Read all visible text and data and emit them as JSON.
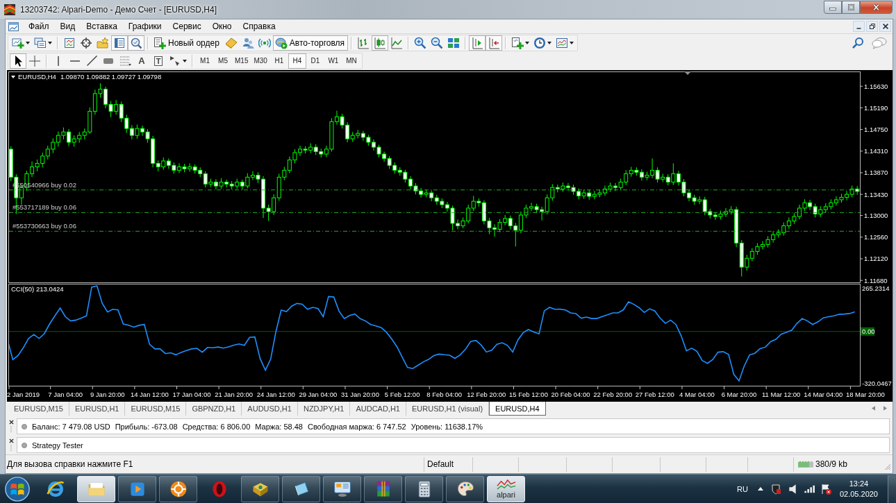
{
  "window": {
    "title": "13203742: Alpari-Demo - Демо Счет - [EURUSD,H4]"
  },
  "menu": [
    "Файл",
    "Вид",
    "Вставка",
    "Графики",
    "Сервис",
    "Окно",
    "Справка"
  ],
  "toolbar": [
    {
      "kind": "new-chart",
      "dropdown": true,
      "pressed": false
    },
    {
      "kind": "profiles",
      "dropdown": true,
      "pressed": false
    },
    {
      "kind": "separator"
    },
    {
      "kind": "market-watch",
      "dropdown": false,
      "pressed": false
    },
    {
      "kind": "data-window",
      "dropdown": false,
      "pressed": false
    },
    {
      "kind": "navigator",
      "dropdown": false,
      "pressed": false
    },
    {
      "kind": "terminal",
      "dropdown": false,
      "pressed": true
    },
    {
      "kind": "tester",
      "dropdown": false,
      "pressed": true
    },
    {
      "kind": "separator"
    },
    {
      "kind": "new-order",
      "label": "Новый ордер",
      "dropdown": false,
      "pressed": false
    },
    {
      "kind": "editor",
      "dropdown": false,
      "pressed": false
    },
    {
      "kind": "signals",
      "dropdown": false,
      "pressed": false
    },
    {
      "kind": "market",
      "dropdown": false,
      "pressed": false
    },
    {
      "kind": "auto-trading",
      "label": "Авто-торговля",
      "dropdown": false,
      "pressed": true
    },
    {
      "kind": "separator"
    },
    {
      "kind": "bar-chart",
      "dropdown": false,
      "pressed": false
    },
    {
      "kind": "candles",
      "dropdown": false,
      "pressed": true
    },
    {
      "kind": "line-chart",
      "dropdown": false,
      "pressed": false
    },
    {
      "kind": "separator"
    },
    {
      "kind": "zoom-in",
      "dropdown": false,
      "pressed": false
    },
    {
      "kind": "zoom-out",
      "dropdown": false,
      "pressed": false
    },
    {
      "kind": "tile",
      "dropdown": false,
      "pressed": false
    },
    {
      "kind": "separator"
    },
    {
      "kind": "chart-shift",
      "dropdown": false,
      "pressed": true
    },
    {
      "kind": "autoscroll",
      "dropdown": false,
      "pressed": true
    },
    {
      "kind": "separator"
    },
    {
      "kind": "indicators",
      "dropdown": true,
      "pressed": false
    },
    {
      "kind": "periods",
      "dropdown": true,
      "pressed": false
    },
    {
      "kind": "templates",
      "dropdown": true,
      "pressed": false
    }
  ],
  "drawing_toolbar": [
    {
      "kind": "cursor",
      "dropdown": false,
      "pressed": true
    },
    {
      "kind": "crosshair",
      "dropdown": false,
      "pressed": false
    },
    {
      "kind": "separator"
    },
    {
      "kind": "vertical-line",
      "dropdown": false,
      "pressed": false
    },
    {
      "kind": "horizontal-line",
      "dropdown": false,
      "pressed": false
    },
    {
      "kind": "trendline",
      "dropdown": false,
      "pressed": false
    },
    {
      "kind": "channel",
      "dropdown": false,
      "pressed": false
    },
    {
      "kind": "fibo",
      "dropdown": false,
      "pressed": false
    },
    {
      "kind": "text",
      "label": "A",
      "dropdown": false,
      "pressed": false
    },
    {
      "kind": "text-label",
      "label": "T",
      "dropdown": false,
      "pressed": false
    },
    {
      "kind": "arrows",
      "dropdown": true,
      "pressed": false
    }
  ],
  "timeframes": [
    {
      "label": "M1",
      "selected": false
    },
    {
      "label": "M5",
      "selected": false
    },
    {
      "label": "M15",
      "selected": false
    },
    {
      "label": "M30",
      "selected": false
    },
    {
      "label": "H1",
      "selected": false
    },
    {
      "label": "H4",
      "selected": true
    },
    {
      "label": "D1",
      "selected": false
    },
    {
      "label": "W1",
      "selected": false
    },
    {
      "label": "MN",
      "selected": false
    }
  ],
  "chart_window": {
    "chart_data": [
      {
        "type": "candlestick",
        "title": "EURUSD,H4",
        "subtitle": "1.09870 1.09882 1.09727 1.09798",
        "tick_labels": "y",
        "ylim": [
          1.1164,
          1.1593
        ],
        "yticks": [
          {
            "value": 1.1563,
            "label": "1.15630"
          },
          {
            "value": 1.1519,
            "label": "1.15190"
          },
          {
            "value": 1.1475,
            "label": "1.14750"
          },
          {
            "value": 1.1431,
            "label": "1.14310"
          },
          {
            "value": 1.1387,
            "label": "1.13870"
          },
          {
            "value": 1.1343,
            "label": "1.13430"
          },
          {
            "value": 1.13,
            "label": "1.13000"
          },
          {
            "value": 1.1256,
            "label": "1.12560"
          },
          {
            "value": 1.1212,
            "label": "1.12120"
          },
          {
            "value": 1.1168,
            "label": "1.11680"
          }
        ],
        "color": "#00ff00",
        "ref_lines": [
          {
            "axis": "y",
            "value": 1.1352,
            "label": "#550540966 buy 0.02",
            "color": "#20b020",
            "line_style": "dashdot"
          },
          {
            "axis": "y",
            "value": 1.1306,
            "label": "#553717189 buy 0.06",
            "color": "#20b020",
            "line_style": "dashdot"
          },
          {
            "axis": "y",
            "value": 1.1268,
            "label": "#553730663 buy 0.06",
            "color": "#20b020",
            "line_style": "dashdot"
          }
        ],
        "ohlc": [
          [
            1.1435,
            1.1441,
            1.137,
            1.1378
          ],
          [
            1.1378,
            1.1384,
            1.1303,
            1.1336
          ],
          [
            1.1336,
            1.1362,
            1.1322,
            1.1357
          ],
          [
            1.1357,
            1.1391,
            1.135,
            1.1385
          ],
          [
            1.1385,
            1.141,
            1.1378,
            1.1399
          ],
          [
            1.1399,
            1.1414,
            1.139,
            1.1406
          ],
          [
            1.1406,
            1.1428,
            1.1398,
            1.1421
          ],
          [
            1.1421,
            1.1442,
            1.1414,
            1.1435
          ],
          [
            1.1435,
            1.1457,
            1.1427,
            1.1449
          ],
          [
            1.1449,
            1.1471,
            1.144,
            1.1463
          ],
          [
            1.1463,
            1.1479,
            1.1455,
            1.147
          ],
          [
            1.147,
            1.1476,
            1.1441,
            1.1449
          ],
          [
            1.1449,
            1.1463,
            1.144,
            1.1456
          ],
          [
            1.1456,
            1.147,
            1.1448,
            1.1463
          ],
          [
            1.1463,
            1.1477,
            1.1455,
            1.147
          ],
          [
            1.147,
            1.152,
            1.1466,
            1.1512
          ],
          [
            1.1512,
            1.1556,
            1.1505,
            1.1548
          ],
          [
            1.1548,
            1.1569,
            1.154,
            1.1557
          ],
          [
            1.1557,
            1.1562,
            1.1518,
            1.1526
          ],
          [
            1.1526,
            1.1533,
            1.15,
            1.1512
          ],
          [
            1.1512,
            1.1535,
            1.1505,
            1.1526
          ],
          [
            1.1526,
            1.1532,
            1.149,
            1.1498
          ],
          [
            1.1498,
            1.1505,
            1.1468,
            1.1477
          ],
          [
            1.1477,
            1.1484,
            1.1455,
            1.1463
          ],
          [
            1.1463,
            1.1485,
            1.1456,
            1.1477
          ],
          [
            1.1477,
            1.1483,
            1.1462,
            1.147
          ],
          [
            1.147,
            1.1476,
            1.1448,
            1.1456
          ],
          [
            1.1456,
            1.1462,
            1.1398,
            1.1406
          ],
          [
            1.1406,
            1.1412,
            1.139,
            1.1399
          ],
          [
            1.1399,
            1.1418,
            1.1393,
            1.1411
          ],
          [
            1.1411,
            1.1416,
            1.1395,
            1.1402
          ],
          [
            1.1402,
            1.1408,
            1.1385,
            1.1392
          ],
          [
            1.1392,
            1.1406,
            1.1386,
            1.1399
          ],
          [
            1.1399,
            1.1405,
            1.1388,
            1.1395
          ],
          [
            1.1395,
            1.1406,
            1.1389,
            1.1399
          ],
          [
            1.1399,
            1.1404,
            1.1385,
            1.1392
          ],
          [
            1.1392,
            1.1398,
            1.1378,
            1.1385
          ],
          [
            1.1385,
            1.139,
            1.1357,
            1.1364
          ],
          [
            1.1364,
            1.1375,
            1.1358,
            1.1368
          ],
          [
            1.1368,
            1.1374,
            1.1353,
            1.136
          ],
          [
            1.136,
            1.1376,
            1.1354,
            1.1368
          ],
          [
            1.1368,
            1.1373,
            1.1357,
            1.1364
          ],
          [
            1.1364,
            1.137,
            1.1353,
            1.136
          ],
          [
            1.136,
            1.1375,
            1.1354,
            1.1368
          ],
          [
            1.1368,
            1.1373,
            1.1352,
            1.136
          ],
          [
            1.136,
            1.1386,
            1.1355,
            1.1378
          ],
          [
            1.1378,
            1.139,
            1.1372,
            1.1382
          ],
          [
            1.1382,
            1.1388,
            1.1366,
            1.1374
          ],
          [
            1.1374,
            1.138,
            1.1295,
            1.1315
          ],
          [
            1.1315,
            1.1322,
            1.1289,
            1.1308
          ],
          [
            1.1308,
            1.1343,
            1.1301,
            1.1336
          ],
          [
            1.1336,
            1.1385,
            1.133,
            1.1378
          ],
          [
            1.1378,
            1.1399,
            1.1372,
            1.1392
          ],
          [
            1.1392,
            1.142,
            1.1386,
            1.1413
          ],
          [
            1.1413,
            1.1435,
            1.1406,
            1.1428
          ],
          [
            1.1428,
            1.1442,
            1.1421,
            1.1435
          ],
          [
            1.1435,
            1.1441,
            1.1426,
            1.1433
          ],
          [
            1.1433,
            1.1447,
            1.1427,
            1.1439
          ],
          [
            1.1439,
            1.1445,
            1.1423,
            1.143
          ],
          [
            1.143,
            1.1436,
            1.1418,
            1.1425
          ],
          [
            1.1425,
            1.1442,
            1.1419,
            1.1435
          ],
          [
            1.1435,
            1.1498,
            1.143,
            1.1491
          ],
          [
            1.1491,
            1.1513,
            1.1485,
            1.1501
          ],
          [
            1.1501,
            1.1507,
            1.1477,
            1.1484
          ],
          [
            1.1484,
            1.149,
            1.1449,
            1.1456
          ],
          [
            1.1456,
            1.147,
            1.145,
            1.1463
          ],
          [
            1.1463,
            1.1474,
            1.1457,
            1.1467
          ],
          [
            1.1467,
            1.1472,
            1.1452,
            1.1459
          ],
          [
            1.1459,
            1.1464,
            1.1442,
            1.1449
          ],
          [
            1.1449,
            1.1455,
            1.1432,
            1.1439
          ],
          [
            1.1439,
            1.1444,
            1.1418,
            1.1425
          ],
          [
            1.1425,
            1.143,
            1.1409,
            1.1416
          ],
          [
            1.1416,
            1.1421,
            1.1395,
            1.1402
          ],
          [
            1.1402,
            1.1408,
            1.1385,
            1.1392
          ],
          [
            1.1392,
            1.1398,
            1.1381,
            1.1388
          ],
          [
            1.1388,
            1.1393,
            1.1367,
            1.1374
          ],
          [
            1.1374,
            1.138,
            1.1353,
            1.136
          ],
          [
            1.136,
            1.1366,
            1.1343,
            1.135
          ],
          [
            1.135,
            1.1356,
            1.1336,
            1.1343
          ],
          [
            1.1343,
            1.1352,
            1.1337,
            1.1346
          ],
          [
            1.1346,
            1.1351,
            1.1329,
            1.1336
          ],
          [
            1.1336,
            1.1342,
            1.1322,
            1.1329
          ],
          [
            1.1329,
            1.1335,
            1.1315,
            1.1322
          ],
          [
            1.1322,
            1.1328,
            1.1308,
            1.1315
          ],
          [
            1.1315,
            1.132,
            1.127,
            1.1284
          ],
          [
            1.1284,
            1.1292,
            1.1272,
            1.1279
          ],
          [
            1.1279,
            1.1296,
            1.1274,
            1.1289
          ],
          [
            1.1289,
            1.1322,
            1.1284,
            1.1315
          ],
          [
            1.1315,
            1.134,
            1.1309,
            1.1329
          ],
          [
            1.1329,
            1.1335,
            1.1318,
            1.1326
          ],
          [
            1.1326,
            1.1331,
            1.1282,
            1.1289
          ],
          [
            1.1289,
            1.1295,
            1.1262,
            1.1275
          ],
          [
            1.1275,
            1.1282,
            1.1257,
            1.1272
          ],
          [
            1.1272,
            1.1293,
            1.1266,
            1.1286
          ],
          [
            1.1286,
            1.1301,
            1.128,
            1.1294
          ],
          [
            1.1294,
            1.13,
            1.1272,
            1.1279
          ],
          [
            1.1279,
            1.1285,
            1.1237,
            1.127
          ],
          [
            1.127,
            1.1308,
            1.1264,
            1.1301
          ],
          [
            1.1301,
            1.1322,
            1.1295,
            1.1315
          ],
          [
            1.1315,
            1.1326,
            1.1309,
            1.1318
          ],
          [
            1.1318,
            1.1324,
            1.1305,
            1.1312
          ],
          [
            1.1312,
            1.1318,
            1.129,
            1.1308
          ],
          [
            1.1308,
            1.1343,
            1.1302,
            1.1336
          ],
          [
            1.1336,
            1.1364,
            1.133,
            1.1357
          ],
          [
            1.1357,
            1.1363,
            1.1347,
            1.1354
          ],
          [
            1.1354,
            1.1367,
            1.1348,
            1.136
          ],
          [
            1.136,
            1.1366,
            1.135,
            1.1357
          ],
          [
            1.1357,
            1.1363,
            1.1342,
            1.1349
          ],
          [
            1.1349,
            1.1355,
            1.1333,
            1.134
          ],
          [
            1.134,
            1.1353,
            1.1334,
            1.1346
          ],
          [
            1.1346,
            1.1352,
            1.1332,
            1.1339
          ],
          [
            1.1339,
            1.135,
            1.1333,
            1.1343
          ],
          [
            1.1343,
            1.1353,
            1.1337,
            1.1346
          ],
          [
            1.1346,
            1.1361,
            1.134,
            1.1354
          ],
          [
            1.1354,
            1.1367,
            1.1348,
            1.136
          ],
          [
            1.136,
            1.1366,
            1.135,
            1.1357
          ],
          [
            1.1357,
            1.1375,
            1.1351,
            1.1368
          ],
          [
            1.1368,
            1.1392,
            1.1362,
            1.1385
          ],
          [
            1.1385,
            1.1399,
            1.1379,
            1.1392
          ],
          [
            1.1392,
            1.1398,
            1.1381,
            1.1388
          ],
          [
            1.1388,
            1.1394,
            1.1371,
            1.1378
          ],
          [
            1.1378,
            1.1389,
            1.1372,
            1.1382
          ],
          [
            1.1382,
            1.1416,
            1.1376,
            1.1392
          ],
          [
            1.1392,
            1.1398,
            1.1367,
            1.1374
          ],
          [
            1.1374,
            1.1385,
            1.1368,
            1.1378
          ],
          [
            1.1378,
            1.1384,
            1.1361,
            1.1368
          ],
          [
            1.1368,
            1.1406,
            1.1362,
            1.1385
          ],
          [
            1.1385,
            1.1391,
            1.1361,
            1.1368
          ],
          [
            1.1368,
            1.1374,
            1.1339,
            1.1346
          ],
          [
            1.1346,
            1.1352,
            1.1329,
            1.1336
          ],
          [
            1.1336,
            1.1342,
            1.1322,
            1.1329
          ],
          [
            1.1329,
            1.1339,
            1.1323,
            1.1332
          ],
          [
            1.1332,
            1.1338,
            1.1301,
            1.1308
          ],
          [
            1.1308,
            1.1314,
            1.1294,
            1.1301
          ],
          [
            1.1301,
            1.1307,
            1.1291,
            1.1298
          ],
          [
            1.1298,
            1.131,
            1.1292,
            1.1303
          ],
          [
            1.1303,
            1.1315,
            1.1297,
            1.1308
          ],
          [
            1.1308,
            1.1319,
            1.1302,
            1.1312
          ],
          [
            1.1312,
            1.1318,
            1.1236,
            1.1244
          ],
          [
            1.1244,
            1.125,
            1.1176,
            1.1195
          ],
          [
            1.1195,
            1.122,
            1.1188,
            1.1213
          ],
          [
            1.1213,
            1.1234,
            1.1207,
            1.1227
          ],
          [
            1.1227,
            1.1244,
            1.122,
            1.1237
          ],
          [
            1.1237,
            1.1248,
            1.1231,
            1.1241
          ],
          [
            1.1241,
            1.1258,
            1.1235,
            1.1251
          ],
          [
            1.1251,
            1.1268,
            1.1245,
            1.1261
          ],
          [
            1.1261,
            1.1272,
            1.1255,
            1.1265
          ],
          [
            1.1265,
            1.1286,
            1.1259,
            1.1279
          ],
          [
            1.1279,
            1.1296,
            1.1273,
            1.1289
          ],
          [
            1.1289,
            1.1305,
            1.1283,
            1.1298
          ],
          [
            1.1298,
            1.1322,
            1.1292,
            1.1315
          ],
          [
            1.1315,
            1.1333,
            1.1309,
            1.1326
          ],
          [
            1.1326,
            1.1332,
            1.1311,
            1.1318
          ],
          [
            1.1318,
            1.1324,
            1.1296,
            1.1303
          ],
          [
            1.1303,
            1.1319,
            1.1297,
            1.1312
          ],
          [
            1.1312,
            1.1325,
            1.1306,
            1.1318
          ],
          [
            1.1318,
            1.1333,
            1.1312,
            1.1326
          ],
          [
            1.1326,
            1.1339,
            1.132,
            1.1332
          ],
          [
            1.1332,
            1.1344,
            1.1326,
            1.1337
          ],
          [
            1.1337,
            1.135,
            1.1331,
            1.1343
          ],
          [
            1.1343,
            1.1361,
            1.1337,
            1.1354
          ],
          [
            1.1354,
            1.136,
            1.1342,
            1.1349
          ]
        ]
      },
      {
        "type": "line",
        "title": "CCI(50) 213.0424",
        "ylim": [
          -337.7,
          292.8
        ],
        "yticks": [
          {
            "value": 265.2314,
            "label": "265.2314"
          },
          {
            "value": 0,
            "label": "0.00"
          },
          {
            "value": -320.0467,
            "label": "-320.0467"
          }
        ],
        "color": "#1e90ff",
        "ref_lines": [
          {
            "axis": "y",
            "value": 0,
            "color": "#006400"
          }
        ],
        "categories": [
          null,
          null,
          null,
          "2 Jan 2019",
          null,
          null,
          null,
          null,
          null,
          null,
          null,
          "7 Jan 04:00",
          null,
          null,
          null,
          null,
          null,
          null,
          null,
          "9 Jan 20:00",
          null,
          null,
          null,
          null,
          null,
          null,
          null,
          "14 Jan 12:00",
          null,
          null,
          null,
          null,
          null,
          null,
          null,
          "17 Jan 04:00",
          null,
          null,
          null,
          null,
          null,
          null,
          null,
          "21 Jan 20:00",
          null,
          null,
          null,
          null,
          null,
          null,
          null,
          "24 Jan 12:00",
          null,
          null,
          null,
          null,
          null,
          null,
          null,
          "29 Jan 04:00",
          null,
          null,
          null,
          null,
          null,
          null,
          null,
          "31 Jan 20:00",
          null,
          null,
          null,
          null,
          null,
          null,
          null,
          "5 Feb 12:00",
          null,
          null,
          null,
          null,
          null,
          null,
          null,
          "8 Feb 04:00",
          null,
          null,
          null,
          null,
          null,
          null,
          null,
          "12 Feb 20:00",
          null,
          null,
          null,
          null,
          null,
          null,
          null,
          "15 Feb 12:00",
          null,
          null,
          null,
          null,
          null,
          null,
          null,
          "20 Feb 04:00",
          null,
          null,
          null,
          null,
          null,
          null,
          null,
          "22 Feb 20:00",
          null,
          null,
          null,
          null,
          null,
          null,
          null,
          "27 Feb 12:00",
          null,
          null,
          null,
          null,
          null,
          null,
          null,
          "4 Mar 04:00",
          null,
          null,
          null,
          null,
          null,
          null,
          null,
          "6 Mar 20:00",
          null,
          null,
          null,
          null,
          null,
          null,
          null,
          "11 Mar 12:00",
          null,
          null,
          null,
          null,
          null,
          null,
          null,
          "14 Mar 04:00",
          null,
          null,
          null,
          null,
          null,
          null,
          null,
          "18 Mar 20:00"
        ],
        "values": [
          -51,
          -174,
          -149,
          -101,
          -43,
          -19,
          -43,
          -14,
          46,
          97,
          145,
          91,
          65,
          70,
          82,
          97,
          274,
          282,
          174,
          121,
          137,
          133,
          46,
          39,
          27,
          38,
          43,
          -80,
          -108,
          -108,
          -137,
          -132,
          -144,
          -130,
          -118,
          -108,
          -104,
          -128,
          -99,
          -101,
          -96,
          -103,
          -96,
          -84,
          -77,
          -86,
          -36,
          -34,
          -168,
          -239,
          -171,
          -2,
          132,
          123,
          157,
          173,
          169,
          137,
          149,
          142,
          91,
          216,
          213,
          125,
          79,
          99,
          108,
          79,
          65,
          43,
          34,
          24,
          -5,
          -46,
          -94,
          -159,
          -222,
          -229,
          -209,
          -188,
          -173,
          -149,
          -140,
          -144,
          -147,
          -166,
          -145,
          -111,
          -62,
          -55,
          -84,
          -127,
          -116,
          -79,
          -70,
          -86,
          -127,
          -51,
          -7,
          12,
          -3,
          -15,
          128,
          149,
          137,
          138,
          133,
          115,
          111,
          82,
          89,
          80,
          80,
          92,
          103,
          115,
          115,
          133,
          183,
          168,
          147,
          118,
          140,
          127,
          82,
          50,
          70,
          43,
          -27,
          -120,
          -103,
          -123,
          -180,
          -197,
          -173,
          -128,
          -125,
          -142,
          -265,
          -305,
          -212,
          -145,
          -135,
          -106,
          -97,
          -63,
          -48,
          -17,
          -5,
          7,
          50,
          80,
          65,
          43,
          60,
          84,
          91,
          97,
          106,
          108,
          111,
          121,
          null,
          null
        ]
      }
    ]
  },
  "chart_tabs": [
    {
      "label": "EURUSD,M15",
      "selected": false
    },
    {
      "label": "EURUSD,H1",
      "selected": false
    },
    {
      "label": "EURUSD,M15",
      "selected": false
    },
    {
      "label": "GBPNZD,H1",
      "selected": false
    },
    {
      "label": "AUDUSD,H1",
      "selected": false
    },
    {
      "label": "NZDJPY,H1",
      "selected": false
    },
    {
      "label": "AUDCAD,H1",
      "selected": false
    },
    {
      "label": "EURUSD,H1 (visual)",
      "selected": false
    },
    {
      "label": "EURUSD,H4",
      "selected": true
    }
  ],
  "terminal": {
    "account": [
      "Баланс: 7 479.08 USD",
      "Прибыль: -673.08",
      "Средства: 6 806.00",
      "Маржа: 58.48",
      "Свободная маржа: 6 747.52",
      "Уровень: 11638.17%"
    ]
  },
  "tester_panel": {
    "title": "Strategy Tester"
  },
  "status_bar": {
    "help": "Для вызова справки нажмите F1",
    "profile": "Default",
    "traffic": "380/9 kb"
  },
  "taskbar": {
    "apps": [
      {
        "kind": "e-browser",
        "running": false,
        "active": false
      },
      {
        "kind": "folder",
        "running": true,
        "active": true
      },
      {
        "kind": "media",
        "running": true,
        "active": false
      },
      {
        "kind": "sun",
        "running": true,
        "active": false
      },
      {
        "kind": "ring",
        "running": false,
        "active": false
      },
      {
        "kind": "box",
        "running": true,
        "active": false
      },
      {
        "kind": "paper",
        "running": true,
        "active": false
      },
      {
        "kind": "monitor",
        "running": true,
        "active": false
      },
      {
        "kind": "books",
        "running": true,
        "active": false
      },
      {
        "kind": "calculator",
        "running": true,
        "active": false
      },
      {
        "kind": "palette",
        "running": true,
        "active": false
      },
      {
        "kind": "chart-app",
        "label": "alpari",
        "running": true,
        "active": true
      }
    ],
    "language": "RU",
    "time": "13:24",
    "date": "02.05.2020"
  }
}
